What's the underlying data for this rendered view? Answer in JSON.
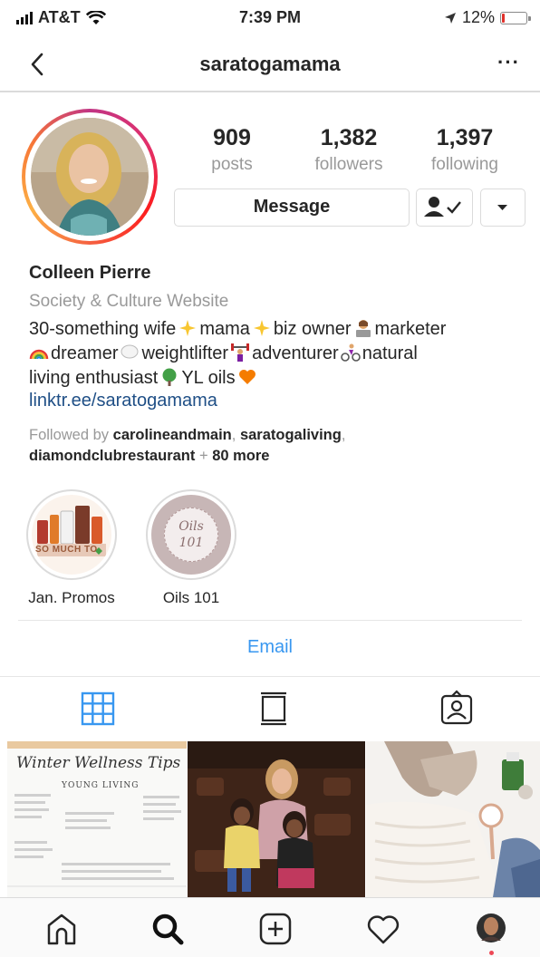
{
  "status_bar": {
    "carrier": "AT&T",
    "time": "7:39 PM",
    "battery": "12%",
    "battery_level": 0.12,
    "battery_color": "#e0322c"
  },
  "header": {
    "username": "saratogamama",
    "more": "···"
  },
  "stats": [
    {
      "value": "909",
      "label": "posts"
    },
    {
      "value": "1,382",
      "label": "followers"
    },
    {
      "value": "1,397",
      "label": "following"
    }
  ],
  "actions": {
    "message": "Message"
  },
  "bio": {
    "name": "Colleen Pierre",
    "category": "Society & Culture Website",
    "line1": {
      "a": "30-something wife",
      "b": "mama",
      "c": "biz owner",
      "d": "marketer"
    },
    "line2": {
      "a": "dreamer",
      "b": "weightlifter",
      "c": "adventurer",
      "d": "natural"
    },
    "line3": {
      "a": "living enthusiast",
      "b": "YL oils"
    },
    "link": "linktr.ee/saratogamama",
    "followed_by_prefix": "Followed by",
    "followed_by_1": "carolineandmain",
    "followed_by_2": "saratogaliving",
    "followed_by_3": "diamondclubrestaurant",
    "followed_by_more": "80 more",
    "comma": ",",
    "plus": " + "
  },
  "highlights": [
    {
      "label": "Jan. Promos",
      "banner": "SO MUCH TO"
    },
    {
      "label": "Oils 101",
      "cover_text_1": "Oils",
      "cover_text_2": "101"
    }
  ],
  "contact": {
    "email": "Email"
  },
  "colors": {
    "accent_blue": "#3897f0",
    "link": "#1f4f86",
    "muted": "#999999",
    "text": "#262626"
  },
  "grid_posts": [
    {
      "title": "Winter Wellness Tips",
      "brand": "YOUNG LIVING"
    },
    {},
    {}
  ],
  "tab_icons": [
    "grid-icon",
    "feed-icon",
    "tagged-icon"
  ],
  "bottom_icons": [
    "home-icon",
    "search-icon",
    "new-post-icon",
    "activity-heart-icon",
    "profile-avatar-icon"
  ]
}
